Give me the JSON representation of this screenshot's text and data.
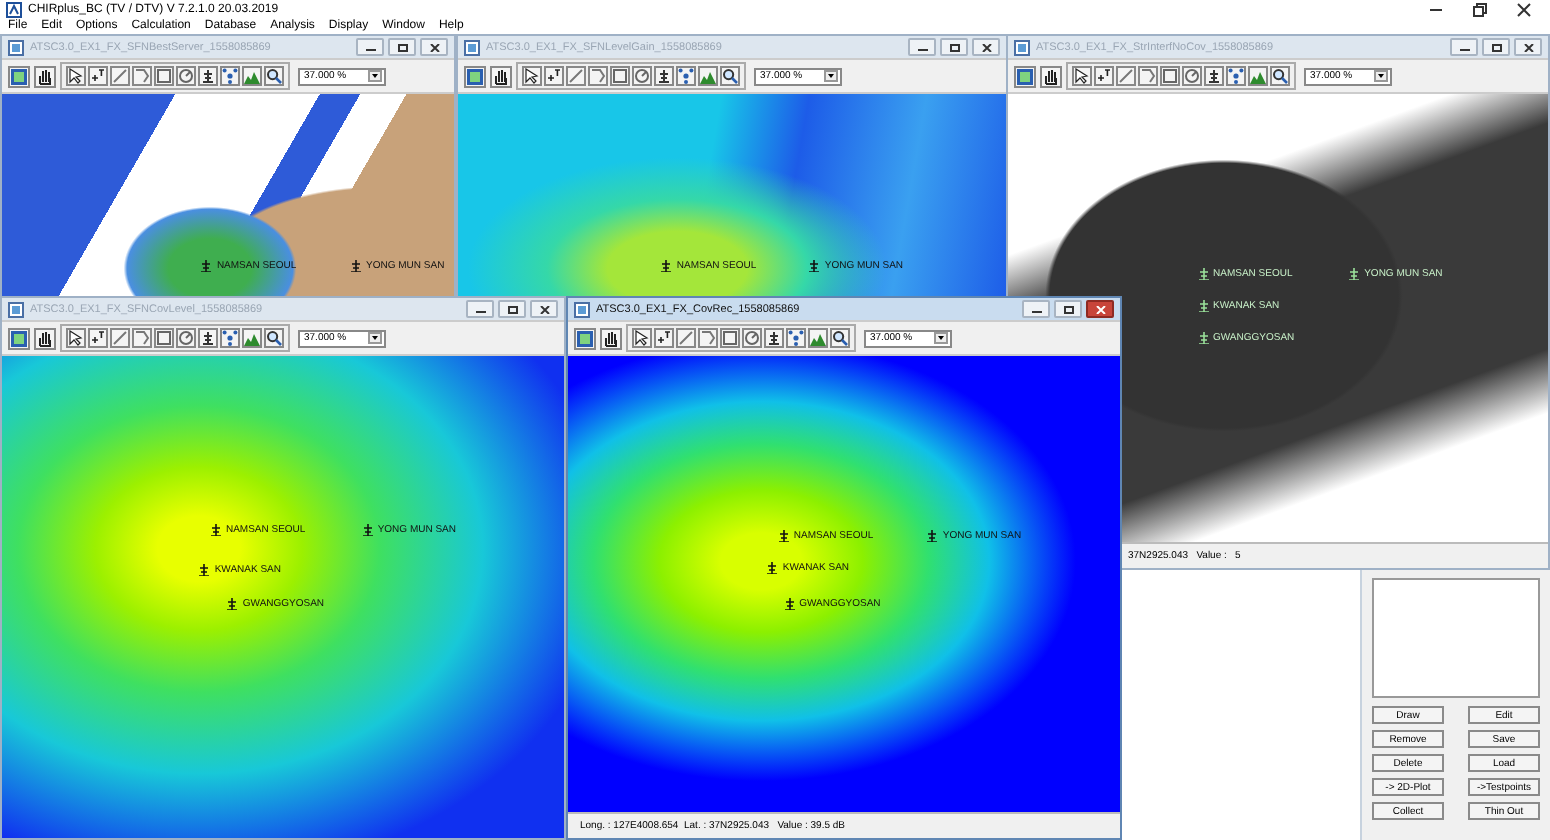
{
  "app": {
    "title": "CHIRplus_BC (TV / DTV)  V 7.2.1.0  20.03.2019"
  },
  "menu": [
    "File",
    "Edit",
    "Options",
    "Calculation",
    "Database",
    "Analysis",
    "Display",
    "Window",
    "Help"
  ],
  "windows": [
    {
      "title": "ATSC3.0_EX1_FX_SFNBestServer_1558085869",
      "active": false,
      "kind": "best_server",
      "zoom": "37.000 %",
      "sites": [
        {
          "name": "NAMSAN SEOUL"
        },
        {
          "name": "YONG MUN SAN"
        }
      ]
    },
    {
      "title": "ATSC3.0_EX1_FX_SFNLevelGain_1558085869",
      "active": false,
      "kind": "level_gain",
      "zoom": "37.000 %",
      "sites": [
        {
          "name": "NAMSAN SEOUL"
        },
        {
          "name": "YONG MUN SAN"
        }
      ]
    },
    {
      "title": "ATSC3.0_EX1_FX_StrInterfNoCov_1558085869",
      "active": false,
      "kind": "interference",
      "zoom": "37.000 %",
      "sites": [
        {
          "name": "NAMSAN SEOUL"
        },
        {
          "name": "YONG MUN SAN"
        },
        {
          "name": "KWANAK SAN"
        },
        {
          "name": "GWANGGYOSAN"
        }
      ],
      "status": "37N2925.043   Value :   5"
    },
    {
      "title": "ATSC3.0_EX1_FX_SFNCovLevel_1558085869",
      "active": false,
      "kind": "coverage",
      "zoom": "37.000 %",
      "sites": [
        {
          "name": "NAMSAN SEOUL"
        },
        {
          "name": "YONG MUN SAN"
        },
        {
          "name": "KWANAK SAN"
        },
        {
          "name": "GWANGGYOSAN"
        }
      ]
    },
    {
      "title": "ATSC3.0_EX1_FX_CovRec_1558085869",
      "active": true,
      "kind": "coverage_rec",
      "zoom": "37.000 %",
      "sites": [
        {
          "name": "NAMSAN SEOUL"
        },
        {
          "name": "YONG MUN SAN"
        },
        {
          "name": "KWANAK SAN"
        },
        {
          "name": "GWANGGYOSAN"
        }
      ],
      "status": "Long. : 127E4008.654  Lat. : 37N2925.043   Value : 39.5 dB"
    }
  ],
  "panel": {
    "buttons": [
      "Draw",
      "Edit",
      "Remove",
      "Save",
      "Delete",
      "Load",
      "-> 2D-Plot",
      "->Testpoints",
      "Collect",
      "Thin Out"
    ]
  }
}
